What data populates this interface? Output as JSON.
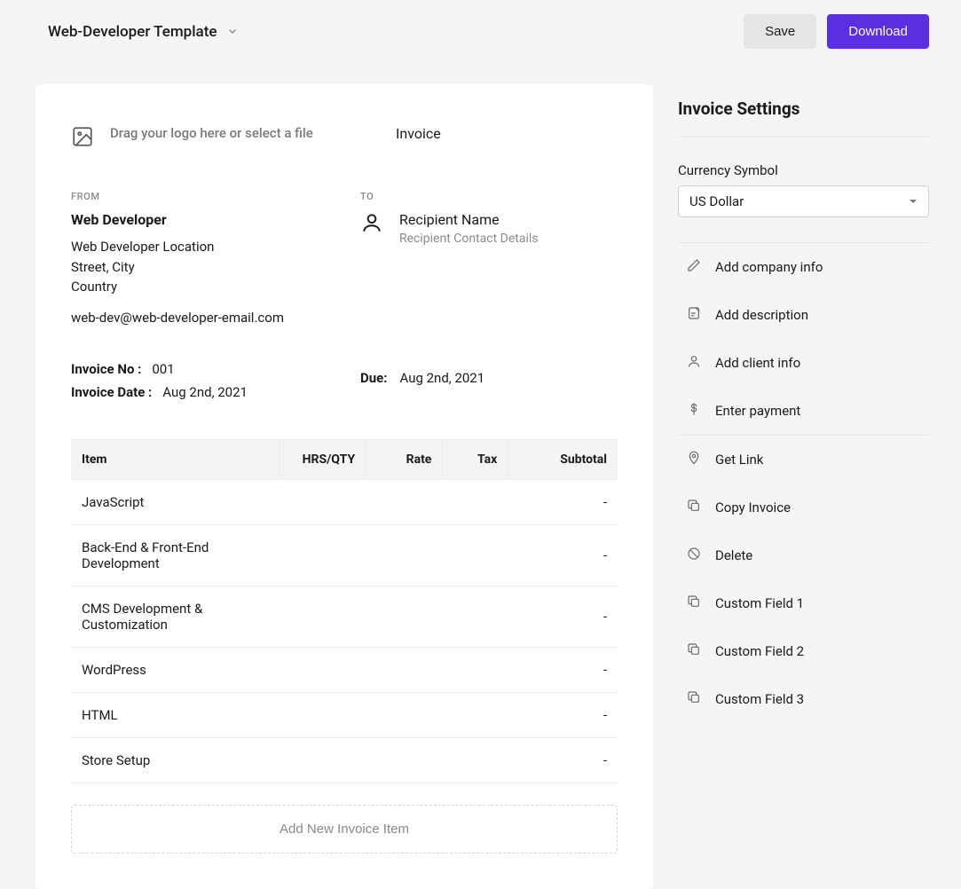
{
  "header": {
    "template_name": "Web-Developer Template",
    "save_label": "Save",
    "download_label": "Download"
  },
  "invoice": {
    "logo_drop_text": "Drag your logo here or select a file",
    "title": "Invoice",
    "from_label": "FROM",
    "to_label": "TO",
    "from": {
      "name": "Web Developer",
      "address_line1": "Web Developer Location",
      "address_line2": "Street, City",
      "address_line3": "Country",
      "email": "web-dev@web-developer-email.com"
    },
    "to": {
      "name_placeholder": "Recipient Name",
      "contact_placeholder": "Recipient Contact Details"
    },
    "invoice_no_label": "Invoice No :",
    "invoice_no": "001",
    "invoice_date_label": "Invoice Date :",
    "invoice_date": "Aug 2nd, 2021",
    "due_label": "Due:",
    "due_date": "Aug 2nd, 2021",
    "columns": {
      "item": "Item",
      "qty": "HRS/QTY",
      "rate": "Rate",
      "tax": "Tax",
      "subtotal": "Subtotal"
    },
    "items": [
      {
        "name": "JavaScript",
        "subtotal": "-"
      },
      {
        "name": "Back-End & Front-End Development",
        "subtotal": "-"
      },
      {
        "name": "CMS Development & Customization",
        "subtotal": "-"
      },
      {
        "name": "WordPress",
        "subtotal": "-"
      },
      {
        "name": "HTML",
        "subtotal": "-"
      },
      {
        "name": "Store Setup",
        "subtotal": "-"
      }
    ],
    "add_item_label": "Add New Invoice Item"
  },
  "settings": {
    "title": "Invoice Settings",
    "currency_label": "Currency Symbol",
    "currency_value": "US Dollar",
    "group1": [
      {
        "icon": "pencil",
        "label": "Add company info"
      },
      {
        "icon": "note",
        "label": "Add description"
      },
      {
        "icon": "person",
        "label": "Add client info"
      },
      {
        "icon": "dollar",
        "label": "Enter payment"
      }
    ],
    "group2": [
      {
        "icon": "pin",
        "label": "Get Link"
      },
      {
        "icon": "copy",
        "label": "Copy Invoice"
      },
      {
        "icon": "cancel",
        "label": "Delete"
      },
      {
        "icon": "copy",
        "label": "Custom Field 1"
      },
      {
        "icon": "copy",
        "label": "Custom Field 2"
      },
      {
        "icon": "copy",
        "label": "Custom Field 3"
      }
    ]
  }
}
